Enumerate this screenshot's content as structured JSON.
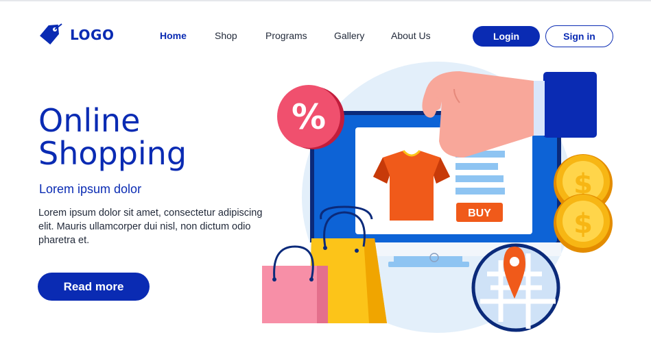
{
  "logo": {
    "text": "LOGO",
    "icon": "price-tag-icon"
  },
  "nav": {
    "items": [
      {
        "label": "Home",
        "active": true
      },
      {
        "label": "Shop",
        "active": false
      },
      {
        "label": "Programs",
        "active": false
      },
      {
        "label": "Gallery",
        "active": false
      },
      {
        "label": "About Us",
        "active": false
      }
    ]
  },
  "auth": {
    "login_label": "Login",
    "signin_label": "Sign in"
  },
  "hero": {
    "title_line1": "Online",
    "title_line2": "Shopping",
    "subtitle": "Lorem ipsum dolor",
    "body": "Lorem ipsum dolor sit amet, consectetur adipiscing elit. Mauris ullamcorper dui nisl, non dictum odio pharetra et.",
    "cta_label": "Read more"
  },
  "illustration": {
    "discount_badge": "%",
    "buy_label": "BUY",
    "coin_symbol": "$",
    "icons": [
      "percent-badge-icon",
      "hand-icon",
      "t-shirt-icon",
      "shopping-bag-icon",
      "dollar-coin-icon",
      "map-pin-icon",
      "monitor-icon"
    ]
  },
  "colors": {
    "brand_blue": "#0a2bb3",
    "accent_orange": "#f05a1a",
    "badge_red": "#f0506e",
    "coin_yellow": "#f7b614",
    "bag_yellow": "#fcc419",
    "bag_pink": "#f78fa7"
  }
}
